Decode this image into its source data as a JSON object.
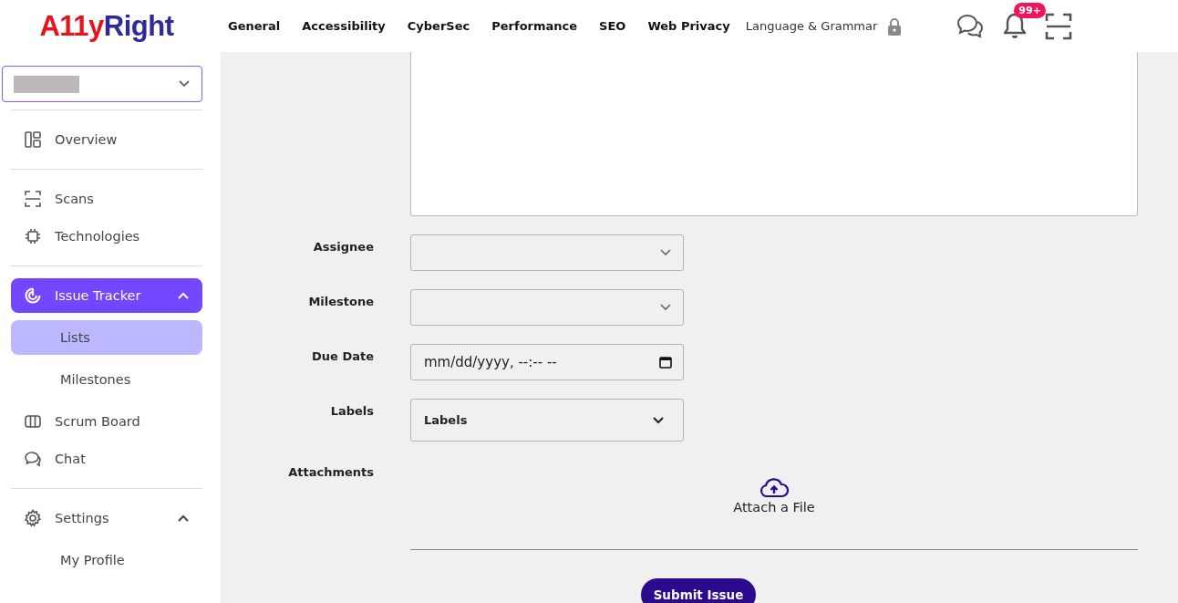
{
  "logo": {
    "accent": "A11y",
    "main": "Right"
  },
  "nav": [
    {
      "label": "General",
      "locked": false
    },
    {
      "label": "Accessibility",
      "locked": false
    },
    {
      "label": "CyberSec",
      "locked": false
    },
    {
      "label": "Performance",
      "locked": false
    },
    {
      "label": "SEO",
      "locked": false
    },
    {
      "label": "Web Privacy",
      "locked": false
    },
    {
      "label": "Language & Grammar",
      "locked": true
    }
  ],
  "notifications": {
    "badge": "99+"
  },
  "sidebar": {
    "groups": [
      [
        {
          "label": "Overview",
          "selected": false
        }
      ],
      [
        {
          "label": "Scans",
          "selected": false
        },
        {
          "label": "Technologies",
          "selected": false
        }
      ],
      [
        {
          "label": "Issue Tracker",
          "selected": true,
          "expanded": true,
          "children": [
            {
              "label": "Lists",
              "selected": true
            },
            {
              "label": "Milestones",
              "selected": false
            }
          ]
        },
        {
          "label": "Scrum Board",
          "selected": false
        },
        {
          "label": "Chat",
          "selected": false
        }
      ],
      [
        {
          "label": "Settings",
          "selected": false,
          "expanded": true,
          "children": [
            {
              "label": "My Profile",
              "selected": false
            }
          ]
        }
      ]
    ]
  },
  "form": {
    "fields": [
      {
        "label": "Assignee",
        "kind": "select"
      },
      {
        "label": "Milestone",
        "kind": "select"
      },
      {
        "label": "Due Date",
        "kind": "date",
        "value": "mm/dd/yyyy, --:-- --"
      },
      {
        "label": "Labels",
        "kind": "multiselect",
        "value": "Labels"
      }
    ],
    "attachments": {
      "label": "Attachments",
      "action": "Attach a File"
    },
    "submit": "Submit Issue"
  }
}
